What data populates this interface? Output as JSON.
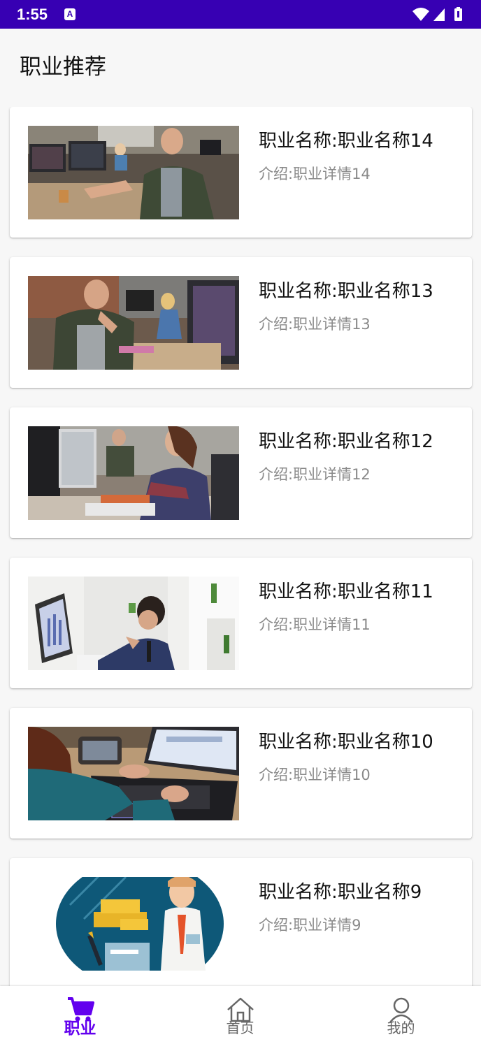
{
  "status_bar": {
    "time": "1:55",
    "notification_icon": "a-badge-icon",
    "icons": [
      "wifi-icon",
      "signal-icon",
      "battery-icon"
    ]
  },
  "page": {
    "title": "职业推荐"
  },
  "careers": [
    {
      "title": "职业名称:职业名称14",
      "desc": "介绍:职业详情14",
      "image": "office-man-smiling-photo"
    },
    {
      "title": "职业名称:职业名称13",
      "desc": "介绍:职业详情13",
      "image": "office-man-thinking-photo"
    },
    {
      "title": "职业名称:职业名称12",
      "desc": "介绍:职业详情12",
      "image": "office-woman-at-desk-photo"
    },
    {
      "title": "职业名称:职业名称11",
      "desc": "介绍:职业详情11",
      "image": "businessman-with-monitor-photo"
    },
    {
      "title": "职业名称:职业名称10",
      "desc": "介绍:职业详情10",
      "image": "laptop-typing-photo"
    },
    {
      "title": "职业名称:职业名称9",
      "desc": "介绍:职业详情9",
      "image": "finance-illustration"
    }
  ],
  "bottom_nav": {
    "items": [
      {
        "label": "职业",
        "icon": "cart-icon",
        "active": true
      },
      {
        "label": "首页",
        "icon": "home-icon",
        "active": false
      },
      {
        "label": "我的",
        "icon": "person-icon",
        "active": false
      }
    ]
  },
  "colors": {
    "status_bar": "#3700b3",
    "accent": "#6200ee",
    "background": "#f7f7f7",
    "card": "#ffffff",
    "desc_text": "#8a8a8a"
  }
}
